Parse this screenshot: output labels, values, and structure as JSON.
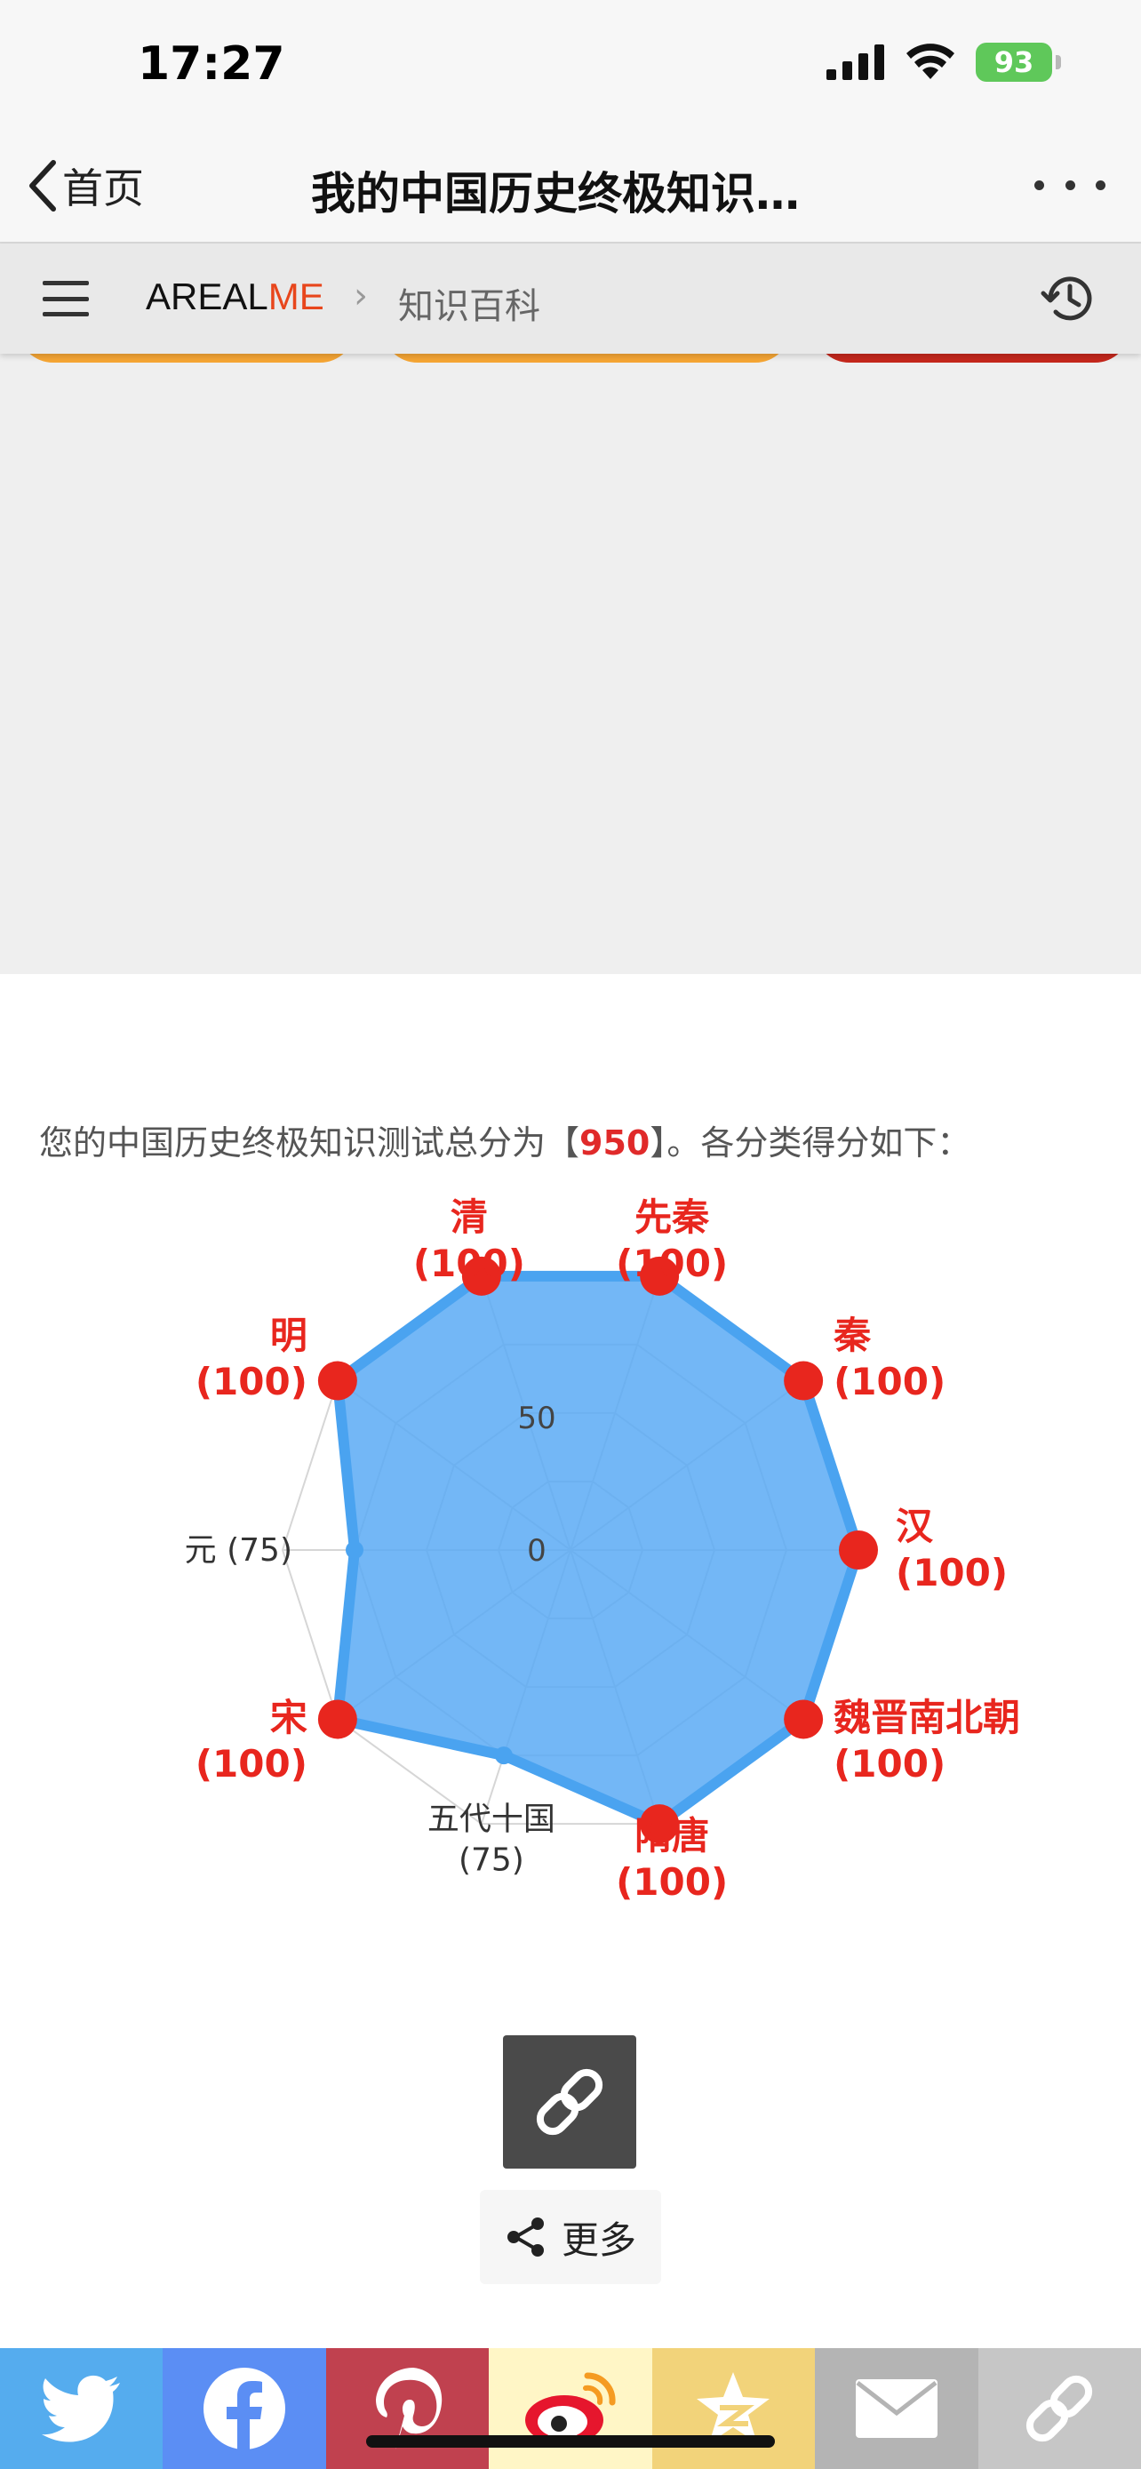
{
  "status_bar": {
    "time": "17:27",
    "battery": "93"
  },
  "nav": {
    "back_label": "首页",
    "title": "我的中国历史终极知识…"
  },
  "site_header": {
    "logo_main": "AREAL",
    "logo_accent": "ME",
    "breadcrumb_sep": "›",
    "breadcrumb": "知识百科"
  },
  "result": {
    "prefix": "您的中国历史终极知识测试总分为【",
    "score": "950",
    "suffix": "】。各分类得分如下："
  },
  "chart_data": {
    "type": "radar",
    "rlim": [
      0,
      100
    ],
    "ticks": [
      0,
      50
    ],
    "categories": [
      "先秦",
      "秦",
      "汉",
      "魏晋南北朝",
      "隋唐",
      "五代十国",
      "宋",
      "元",
      "明",
      "清"
    ],
    "values": [
      100,
      100,
      100,
      100,
      100,
      75,
      100,
      75,
      100,
      100
    ],
    "labels": [
      "(100)",
      "(100)",
      "(100)",
      "(100)",
      "(100)",
      "(75)",
      "(100)",
      "(75)",
      "(100)",
      "(100)"
    ],
    "highlight_color": "#e8261e",
    "fill_color": "#5aaaf5",
    "line_color": "#4aa3f0"
  },
  "share": {
    "more_label": "更多"
  },
  "share_bar": [
    {
      "icon": "twitter-icon",
      "color": "#55acee"
    },
    {
      "icon": "facebook-icon",
      "color": "#3b5998"
    },
    {
      "icon": "pinterest-icon",
      "color": "#cb2027"
    },
    {
      "icon": "weibo-icon",
      "color": "#fff7c8"
    },
    {
      "icon": "qzone-icon",
      "color": "#f5d36e"
    },
    {
      "icon": "email-icon",
      "color": "#b5b5b5"
    },
    {
      "icon": "link-icon",
      "color": "#c8c8c8"
    }
  ]
}
